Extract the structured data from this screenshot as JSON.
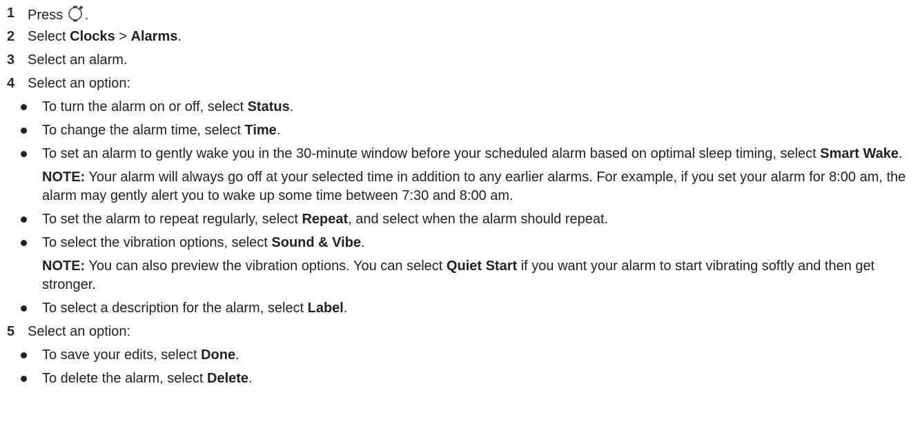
{
  "steps": [
    {
      "num": "1",
      "pre": "Press ",
      "post": "."
    },
    {
      "num": "2",
      "pre": "Select ",
      "b1": "Clocks",
      "mid": " > ",
      "b2": "Alarms",
      "post": "."
    },
    {
      "num": "3",
      "text": "Select an alarm."
    },
    {
      "num": "4",
      "text": "Select an option:"
    },
    {
      "num": "5",
      "text": "Select an option:"
    }
  ],
  "step1_icon": "watch-button-icon",
  "step4_items": [
    {
      "pre": "To turn the alarm on or off, select ",
      "bold": "Status",
      "post": "."
    },
    {
      "pre": "To change the alarm time, select ",
      "bold": "Time",
      "post": "."
    },
    {
      "pre": "To set an alarm to gently wake you in the 30-minute window before your scheduled alarm based on optimal sleep timing, select ",
      "bold": "Smart Wake",
      "post": "."
    },
    {
      "pre": "To set the alarm to repeat regularly, select ",
      "bold": "Repeat",
      "post": ", and select when the alarm should repeat."
    },
    {
      "pre": "To select the vibration options, select ",
      "bold": "Sound & Vibe",
      "post": "."
    },
    {
      "pre": "To select a description for the alarm, select ",
      "bold": "Label",
      "post": "."
    }
  ],
  "note1": {
    "label": "NOTE:",
    "text": " Your alarm will always go off at your selected time in addition to any earlier alarms. For example, if you set your alarm for 8:00 am, the alarm may gently alert you to wake up some time between 7:30 and 8:00 am."
  },
  "note2": {
    "label": "NOTE:",
    "pre": " You can also preview the vibration options. You can select ",
    "bold": "Quiet Start",
    "post": " if you want your alarm to start vibrating softly and then get stronger."
  },
  "step5_items": [
    {
      "pre": "To save your edits, select ",
      "bold": "Done",
      "post": "."
    },
    {
      "pre": "To delete the alarm, select ",
      "bold": "Delete",
      "post": "."
    }
  ]
}
